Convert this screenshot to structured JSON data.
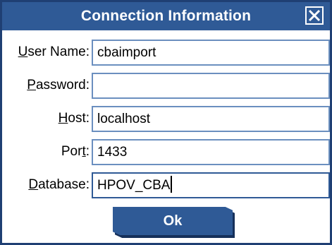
{
  "dialog": {
    "title": "Connection Information",
    "close_icon": "close-icon"
  },
  "fields": {
    "user_name": {
      "label_pre": "",
      "label_u": "U",
      "label_post": "ser Name:",
      "value": "cbaimport"
    },
    "password": {
      "label_pre": "",
      "label_u": "P",
      "label_post": "assword:",
      "value": ""
    },
    "host": {
      "label_pre": "",
      "label_u": "H",
      "label_post": "ost:",
      "value": "localhost"
    },
    "port": {
      "label_pre": "Por",
      "label_u": "t",
      "label_post": ":",
      "value": "1433"
    },
    "database": {
      "label_pre": "",
      "label_u": "D",
      "label_post": "atabase:",
      "value": "HPOV_CBA"
    }
  },
  "buttons": {
    "ok_label": "Ok"
  },
  "colors": {
    "accent": "#2f5a96",
    "border": "#1f3f73",
    "field_border": "#6b8fbf"
  }
}
